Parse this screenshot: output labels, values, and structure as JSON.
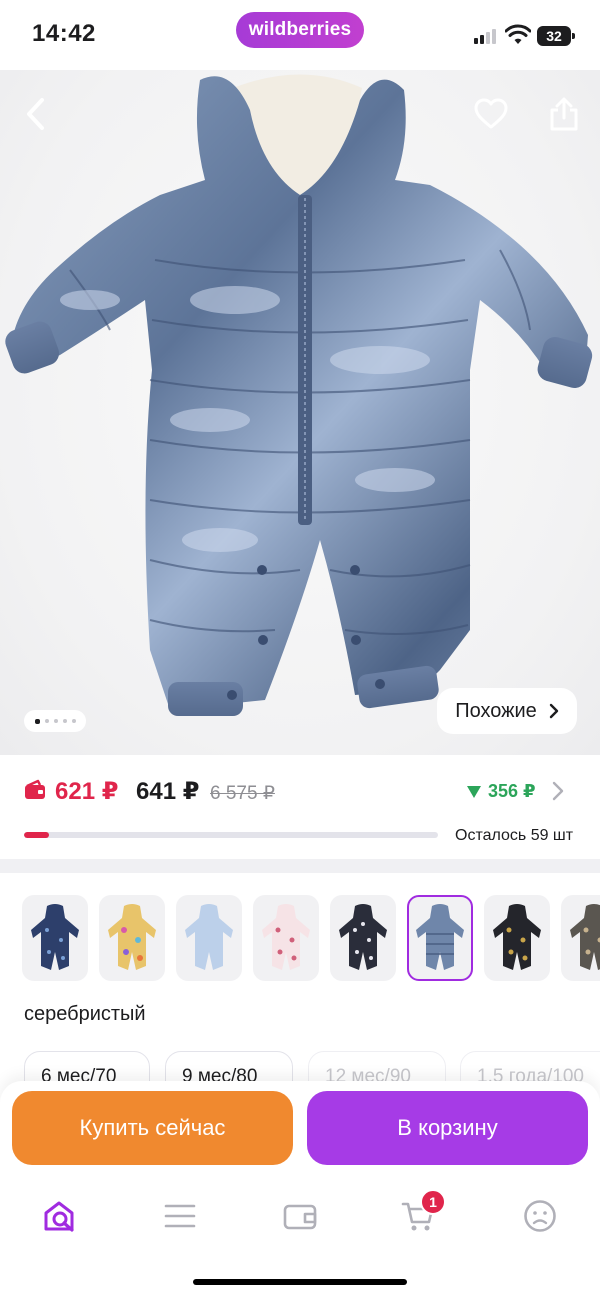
{
  "status_bar": {
    "time": "14:42",
    "brand": "wildberries",
    "battery": "32"
  },
  "hero": {
    "back_icon": "chevron-left-icon",
    "favorite_icon": "heart-icon",
    "share_icon": "share-icon",
    "gallery_dots": 5,
    "gallery_active_index": 0,
    "similar_label": "Похожие"
  },
  "price": {
    "wallet_price": "621 ₽",
    "price": "641 ₽",
    "old_price": "6 575 ₽",
    "saving": "356 ₽",
    "stock_text": "Осталось 59 шт",
    "stock_fraction": 0.06,
    "colors": {
      "wallet": "#e0254b",
      "saving": "#2ca55a"
    }
  },
  "variants": {
    "selected_index": 5,
    "color_name": "серебристый",
    "thumbs": [
      "navy-print",
      "multicolor-print",
      "light-blue",
      "pink-floral",
      "black-white-print",
      "silver-metallic",
      "black-leopard",
      "grey-leopard"
    ],
    "sizes": [
      {
        "label": "6 мес/70",
        "available": true
      },
      {
        "label": "9 мес/80",
        "available": true
      },
      {
        "label": "12 мес/90",
        "available": false
      },
      {
        "label": "1,5 года/100",
        "available": false
      }
    ]
  },
  "actions": {
    "buy_now": "Купить сейчас",
    "add_to_cart": "В корзину"
  },
  "tabbar": {
    "items": [
      "home-icon",
      "catalog-icon",
      "wallet-icon",
      "cart-icon",
      "profile-icon"
    ],
    "cart_badge": "1",
    "accent": "#a02be0"
  }
}
